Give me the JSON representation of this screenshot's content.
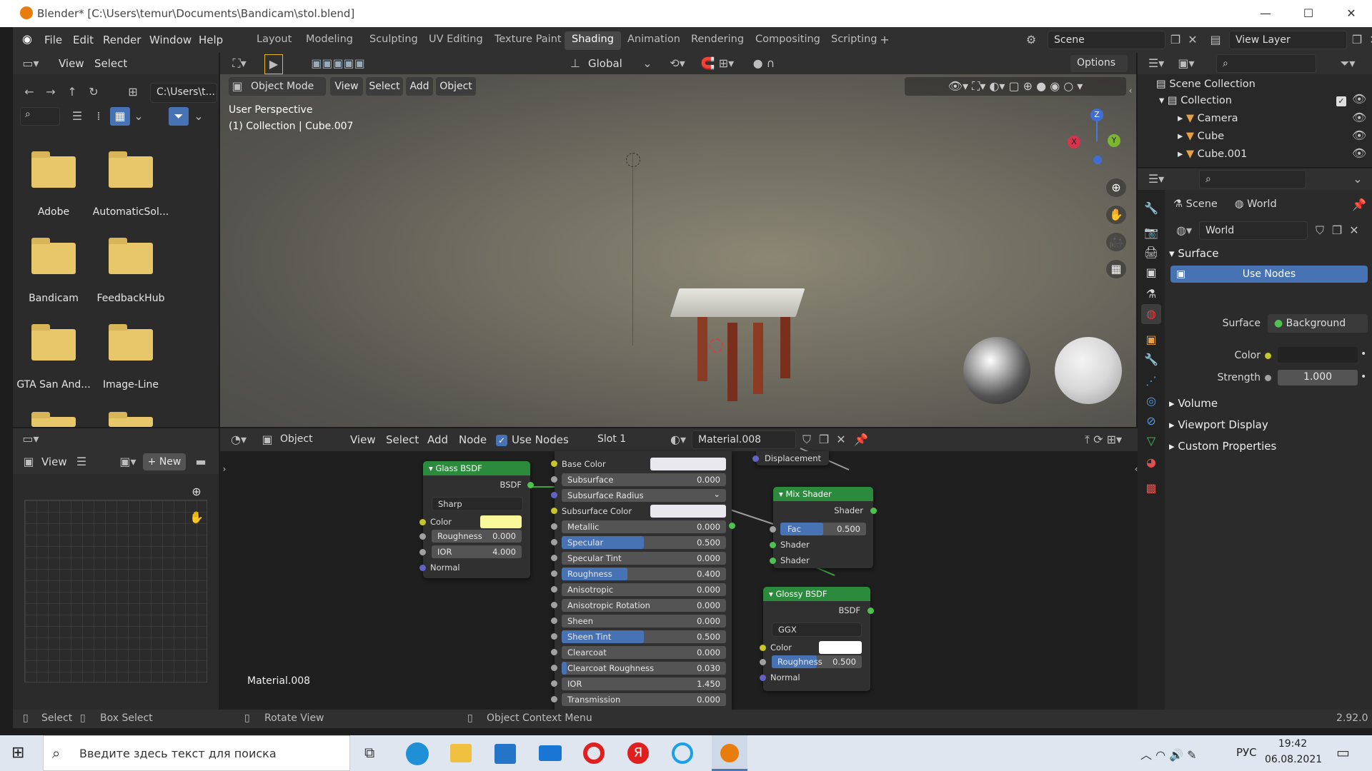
{
  "window": {
    "title": "Blender* [C:\\Users\\temur\\Documents\\Bandicam\\stol.blend]",
    "min": "—",
    "max": "☐",
    "close": "✕"
  },
  "menus": [
    "File",
    "Edit",
    "Render",
    "Window",
    "Help"
  ],
  "workspaces": [
    "Layout",
    "Modeling",
    "Sculpting",
    "UV Editing",
    "Texture Paint",
    "Shading",
    "Animation",
    "Rendering",
    "Compositing",
    "Scripting"
  ],
  "active_workspace": "Shading",
  "scene": {
    "label": "Scene",
    "view_layer": "View Layer"
  },
  "filebrowser": {
    "view": "View",
    "select": "Select",
    "path": "C:\\Users\\t...",
    "folders": [
      "Adobe",
      "AutomaticSol...",
      "Bandicam",
      "FeedbackHub",
      "GTA San And...",
      "Image-Line"
    ]
  },
  "viewport": {
    "mode": "Object Mode",
    "menus": [
      "View",
      "Select",
      "Add",
      "Object"
    ],
    "transform": "Global",
    "options": "Options",
    "perspective": "User Perspective",
    "collection": "(1) Collection | Cube.007"
  },
  "imageeditor": {
    "view": "View",
    "new": "New"
  },
  "nodeeditor": {
    "type": "Object",
    "menus": [
      "View",
      "Select",
      "Add",
      "Node"
    ],
    "use_nodes": "Use Nodes",
    "slot": "Slot 1",
    "material": "Material.008",
    "material_label": "Material.008"
  },
  "glass": {
    "title": "Glass BSDF",
    "out": "BSDF",
    "dist": "Sharp",
    "color": "Color",
    "roughness": "Roughness",
    "roughness_val": "0.000",
    "ior": "IOR",
    "ior_val": "4.000",
    "normal": "Normal"
  },
  "principled": [
    {
      "l": "Base Color",
      "v": "",
      "t": "color"
    },
    {
      "l": "Subsurface",
      "v": "0.000",
      "f": 0
    },
    {
      "l": "Subsurface Radius",
      "v": "",
      "t": "drop"
    },
    {
      "l": "Subsurface Color",
      "v": "",
      "t": "color"
    },
    {
      "l": "Metallic",
      "v": "0.000",
      "f": 0
    },
    {
      "l": "Specular",
      "v": "0.500",
      "f": 0.5
    },
    {
      "l": "Specular Tint",
      "v": "0.000",
      "f": 0
    },
    {
      "l": "Roughness",
      "v": "0.400",
      "f": 0.4
    },
    {
      "l": "Anisotropic",
      "v": "0.000",
      "f": 0
    },
    {
      "l": "Anisotropic Rotation",
      "v": "0.000",
      "f": 0
    },
    {
      "l": "Sheen",
      "v": "0.000",
      "f": 0
    },
    {
      "l": "Sheen Tint",
      "v": "0.500",
      "f": 0.5
    },
    {
      "l": "Clearcoat",
      "v": "0.000",
      "f": 0
    },
    {
      "l": "Clearcoat Roughness",
      "v": "0.030",
      "f": 0.03
    },
    {
      "l": "IOR",
      "v": "1.450",
      "f": 0
    },
    {
      "l": "Transmission",
      "v": "0.000",
      "f": 0
    }
  ],
  "displacement": "Displacement",
  "mix": {
    "title": "Mix Shader",
    "out": "Shader",
    "fac": "Fac",
    "fac_val": "0.500",
    "in1": "Shader",
    "in2": "Shader"
  },
  "glossy": {
    "title": "Glossy BSDF",
    "out": "BSDF",
    "dist": "GGX",
    "color": "Color",
    "roughness": "Roughness",
    "roughness_val": "0.500",
    "normal": "Normal"
  },
  "outliner": {
    "items": [
      "Scene Collection",
      "Collection",
      "Camera",
      "Cube",
      "Cube.001"
    ]
  },
  "properties": {
    "scene": "Scene",
    "world_tab": "World",
    "world": "World",
    "surface_panel": "Surface",
    "use_nodes": "Use Nodes",
    "surface_label": "Surface",
    "surface_val": "Background",
    "color_label": "Color",
    "strength_label": "Strength",
    "strength_val": "1.000",
    "panels": [
      "Volume",
      "Viewport Display",
      "Custom Properties"
    ]
  },
  "statusbar": {
    "select": "Select",
    "box": "Box Select",
    "rotate": "Rotate View",
    "context": "Object Context Menu",
    "version": "2.92.0"
  },
  "taskbar": {
    "search": "Введите здесь текст для поиска",
    "lang": "РУС",
    "time": "19:42",
    "date": "06.08.2021"
  },
  "colors": {
    "accent": "#4772b3",
    "node_green": "#2b8a3e",
    "node_glass": "#2f8a3f",
    "socket_yellow": "#c7c729",
    "socket_green": "#4ec14e",
    "socket_purple": "#6363c7",
    "socket_gray": "#a1a1a1"
  }
}
